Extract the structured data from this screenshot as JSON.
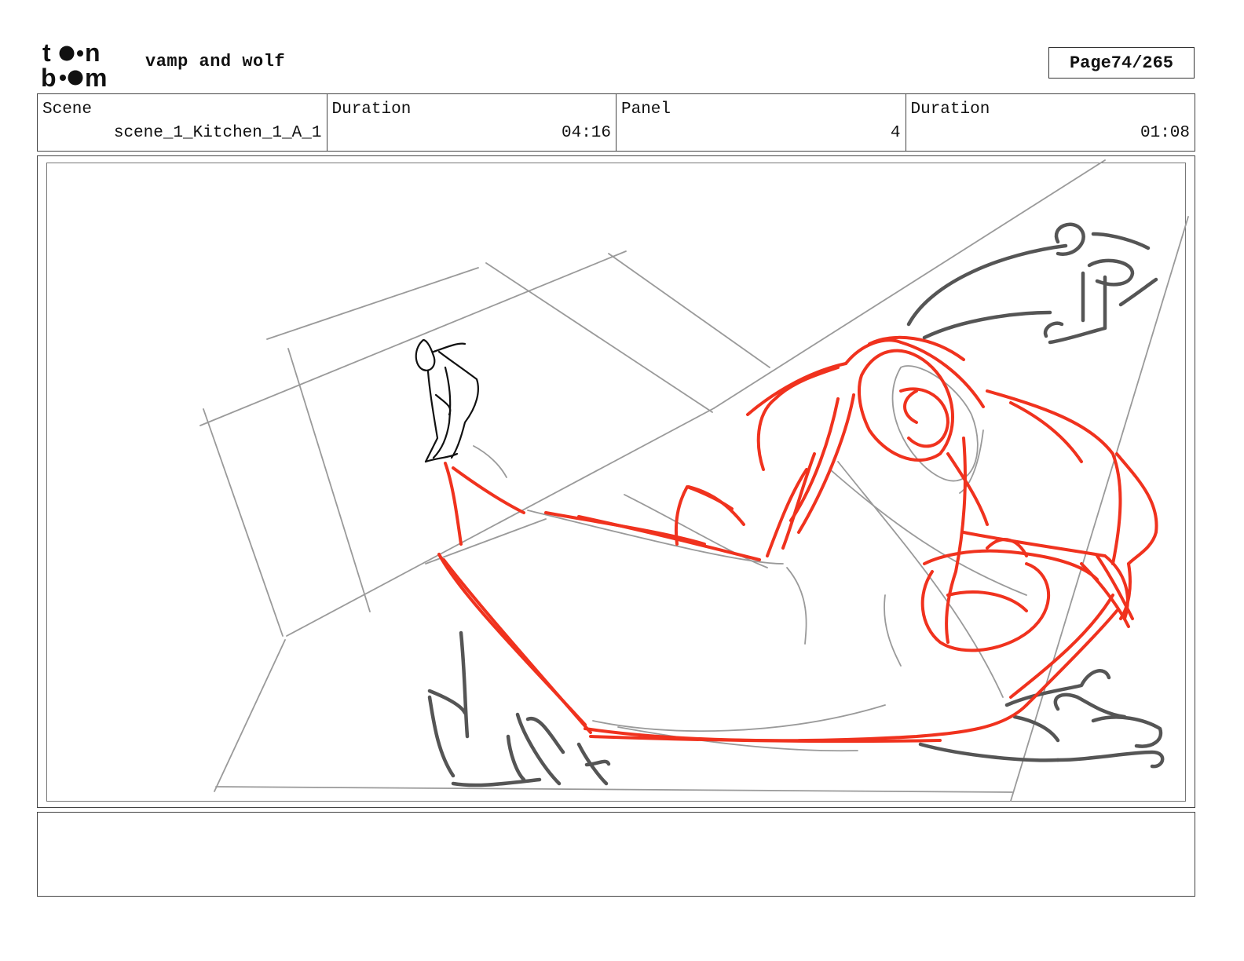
{
  "header": {
    "logo_line1": "toon",
    "logo_line2": "boom",
    "project_title": "vamp and wolf",
    "page_label": "Page",
    "page_number": "74/265"
  },
  "info": {
    "scene_label": "Scene",
    "scene_value": "scene_1_Kitchen_1_A_1",
    "scene_duration_label": "Duration",
    "scene_duration_value": "04:16",
    "panel_label": "Panel",
    "panel_value": "4",
    "panel_duration_label": "Duration",
    "panel_duration_value": "01:08"
  },
  "sketch": {
    "colors": {
      "red": "#f0321e",
      "dark": "#555555",
      "guide": "#9a9a9a",
      "ink": "#111111"
    }
  },
  "notes": {
    "text": ""
  }
}
